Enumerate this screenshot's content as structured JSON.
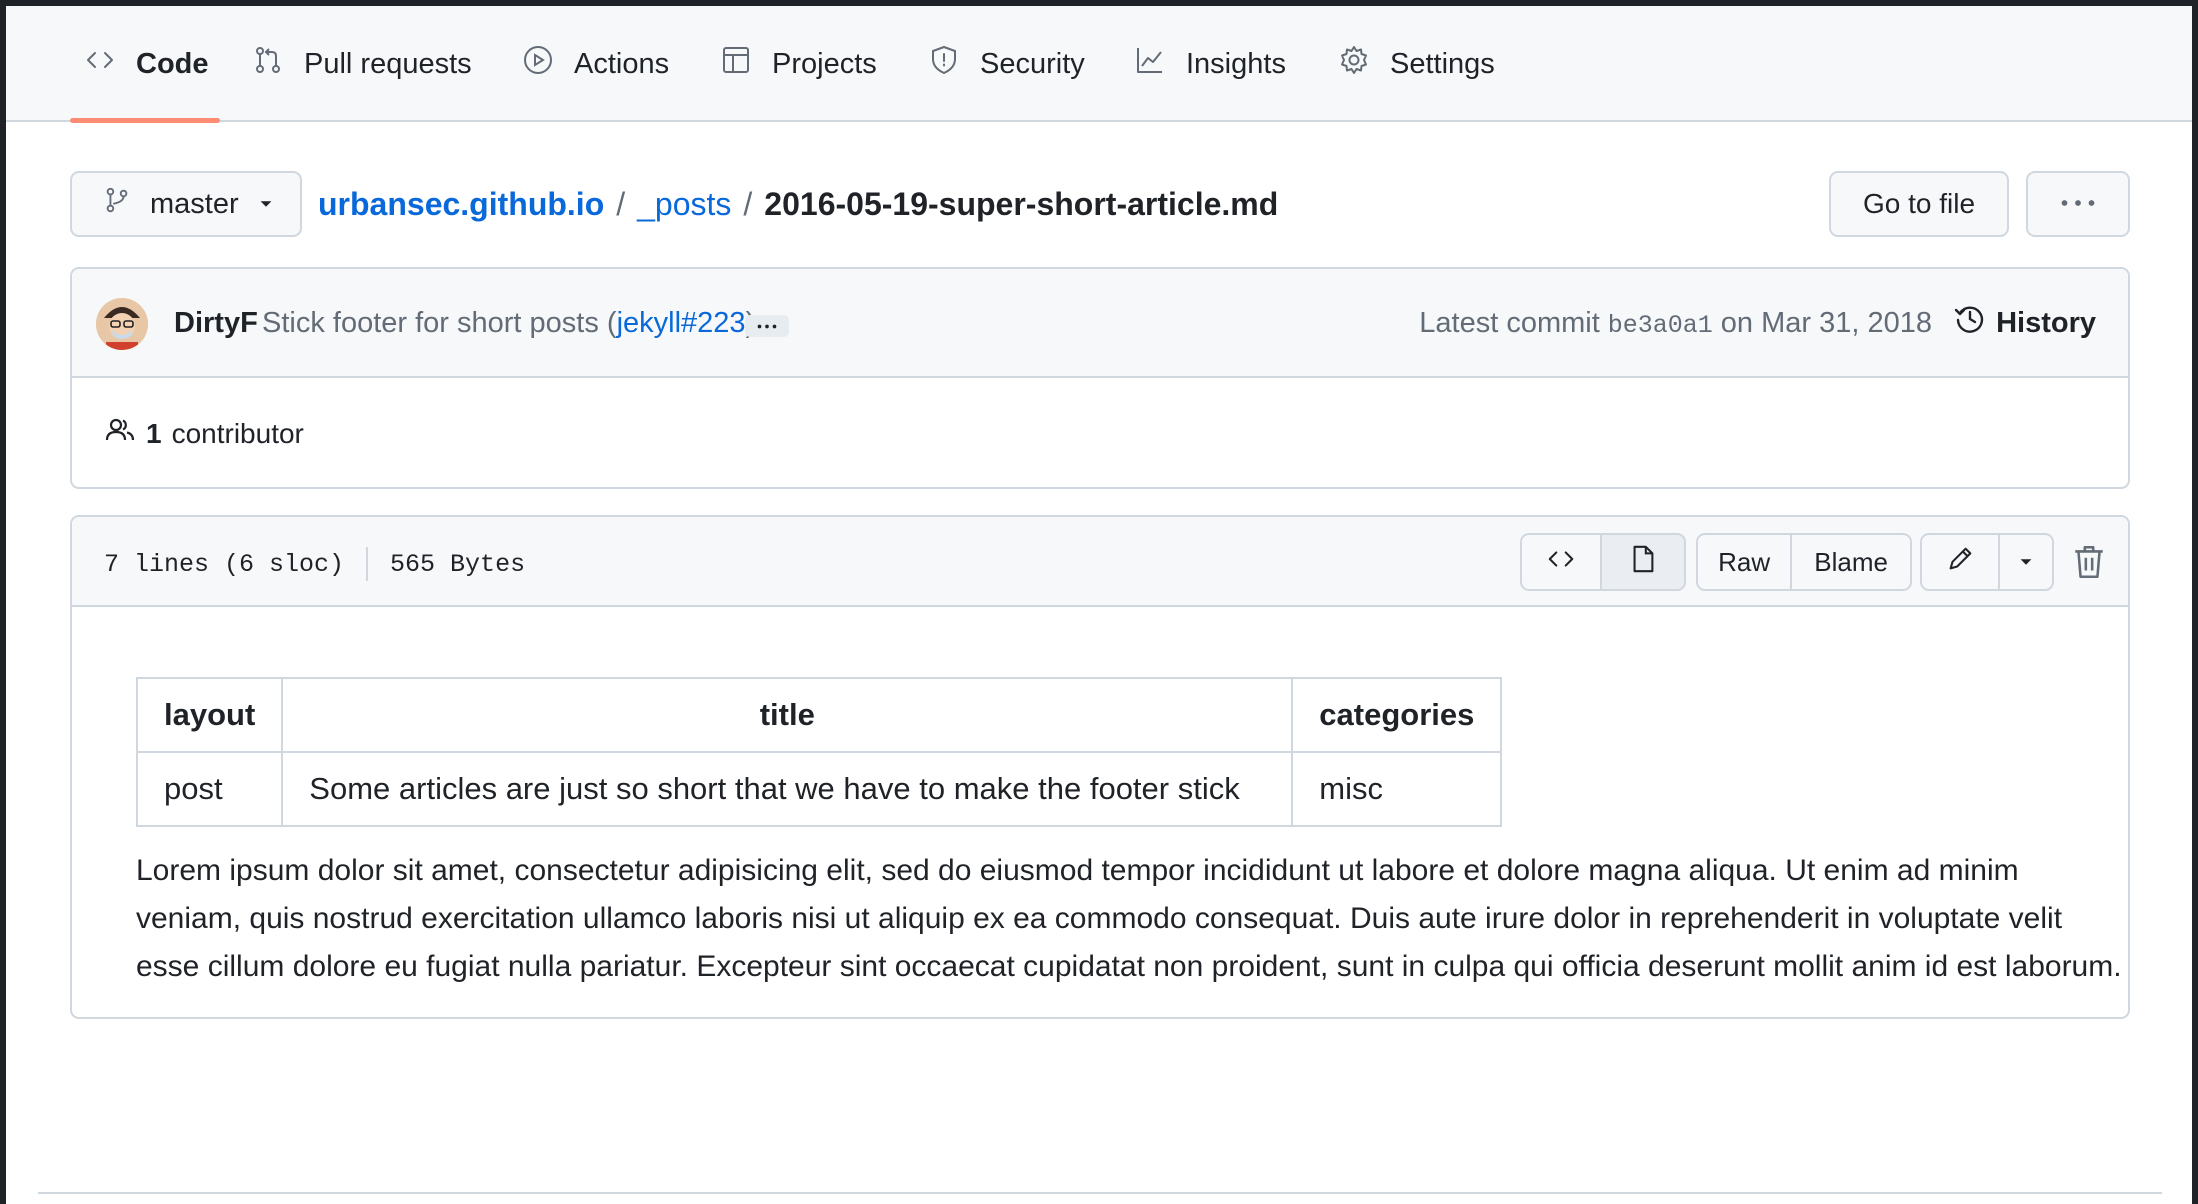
{
  "tabs": [
    {
      "label": "Code",
      "icon": "code-icon",
      "active": true
    },
    {
      "label": "Pull requests",
      "icon": "git-pull-request-icon"
    },
    {
      "label": "Actions",
      "icon": "play-circle-icon"
    },
    {
      "label": "Projects",
      "icon": "table-icon"
    },
    {
      "label": "Security",
      "icon": "shield-icon"
    },
    {
      "label": "Insights",
      "icon": "graph-icon"
    },
    {
      "label": "Settings",
      "icon": "gear-icon"
    }
  ],
  "branch": {
    "label": "master"
  },
  "breadcrumb": {
    "repo": "urbansec.github.io",
    "sep1": "/",
    "folder": "_posts",
    "sep2": "/",
    "file": "2016-05-19-super-short-article.md"
  },
  "actions": {
    "go_to_file": "Go to file"
  },
  "commit": {
    "author": "DirtyF",
    "message_prefix": "Stick footer for short posts (",
    "message_link": "jekyll#223",
    "message_suffix": ")",
    "latest_label": "Latest commit",
    "sha": "be3a0a1",
    "date": "on Mar 31, 2018",
    "history_label": "History"
  },
  "contributors": {
    "count": "1",
    "label": "contributor"
  },
  "file": {
    "lines": "7 lines (6 sloc)",
    "size": "565 Bytes",
    "raw_label": "Raw",
    "blame_label": "Blame"
  },
  "markdown": {
    "table": {
      "headers": [
        "layout",
        "title",
        "categories"
      ],
      "row": [
        "post",
        "Some articles are just so short that we have to make the footer stick",
        "misc"
      ]
    },
    "paragraph": "Lorem ipsum dolor sit amet, consectetur adipisicing elit, sed do eiusmod tempor incididunt ut labore et dolore magna aliqua. Ut enim ad minim veniam, quis nostrud exercitation ullamco laboris nisi ut aliquip ex ea commodo consequat. Duis aute irure dolor in reprehenderit in voluptate velit esse cillum dolore eu fugiat nulla pariatur. Excepteur sint occaecat cupidatat non proident, sunt in culpa qui officia deserunt mollit anim id est laborum."
  },
  "colors": {
    "accent_link": "#0969da",
    "tab_underline": "#fd8c73",
    "border": "#d0d7de",
    "muted_text": "#636c76"
  }
}
